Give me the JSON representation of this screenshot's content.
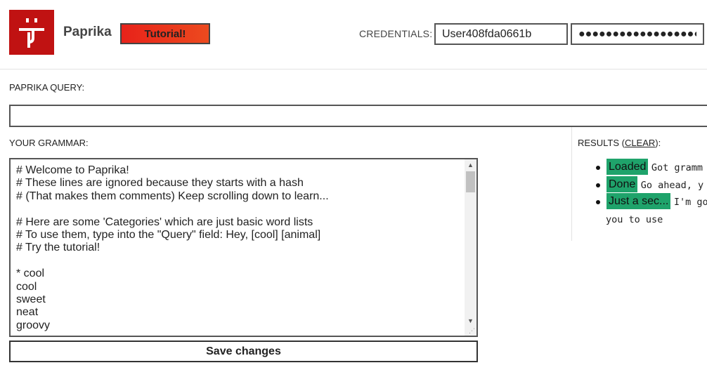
{
  "header": {
    "app_name": "Paprika",
    "tutorial_label": "Tutorial!",
    "credentials_label": "CREDENTIALS:",
    "username_value": "User408fda0661b",
    "password_value": "●●●●●●●●●●●●●●●●●●●●"
  },
  "query": {
    "label": "PAPRIKA QUERY:",
    "value": ""
  },
  "grammar": {
    "label": "YOUR GRAMMAR:",
    "text": "# Welcome to Paprika!\n# These lines are ignored because they starts with a hash\n# (That makes them comments) Keep scrolling down to learn...\n\n# Here are some 'Categories' which are just basic word lists\n# To use them, type into the \"Query\" field: Hey, [cool] [animal]\n# Try the tutorial!\n\n* cool\ncool\nsweet\nneat\ngroovy",
    "save_label": "Save changes"
  },
  "results": {
    "label_prefix": "RESULTS (",
    "clear_label": "CLEAR",
    "label_suffix": "):",
    "items": [
      {
        "status": "Loaded",
        "message": "Got gramm"
      },
      {
        "status": "Done",
        "message": "Go ahead, y"
      },
      {
        "status": "Just a sec...",
        "message": "I'm go"
      }
    ],
    "continuation": "you to use"
  },
  "colors": {
    "logo_bg": "#c01212",
    "tutorial_bg": "#e8221a",
    "status_badge": "#1fa36b"
  },
  "icons": {
    "logo": "paprika-face-logo",
    "scroll_up": "scroll-up-arrow-icon",
    "scroll_down": "scroll-down-arrow-icon",
    "resize": "resize-grip-icon"
  }
}
